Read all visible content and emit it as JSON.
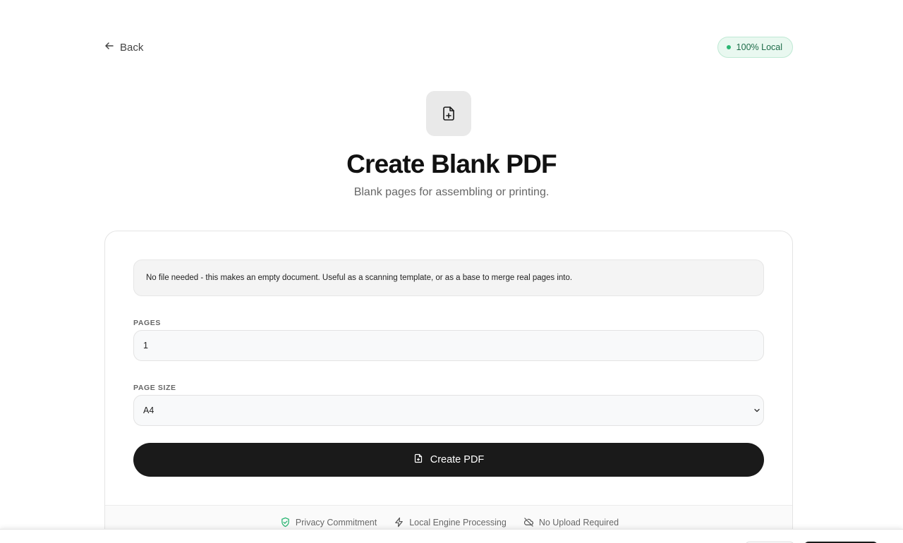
{
  "nav": {
    "back_label": "Back"
  },
  "badge": {
    "label": "100% Local",
    "dot_color": "#2bb673"
  },
  "hero": {
    "icon": "file-plus-icon",
    "title": "Create Blank PDF",
    "subtitle": "Blank pages for assembling or printing."
  },
  "notice": {
    "text": "No file needed - this makes an empty document. Useful as a scanning template, or as a base to merge real pages into."
  },
  "form": {
    "pages_label": "PAGES",
    "pages_value": "1",
    "page_size_label": "PAGE SIZE",
    "page_size_value": "A4",
    "submit_label": "Create PDF"
  },
  "features": [
    {
      "label": "Privacy Commitment",
      "icon": "shield-check-icon"
    },
    {
      "label": "Local Engine Processing",
      "icon": "lightning-icon"
    },
    {
      "label": "No Upload Required",
      "icon": "cloud-off-icon"
    }
  ],
  "colors": {
    "accent": "#1a1a1a",
    "badge_bg": "#e9f8f0",
    "badge_text": "#1d6b49",
    "shield": "#2bb673"
  }
}
